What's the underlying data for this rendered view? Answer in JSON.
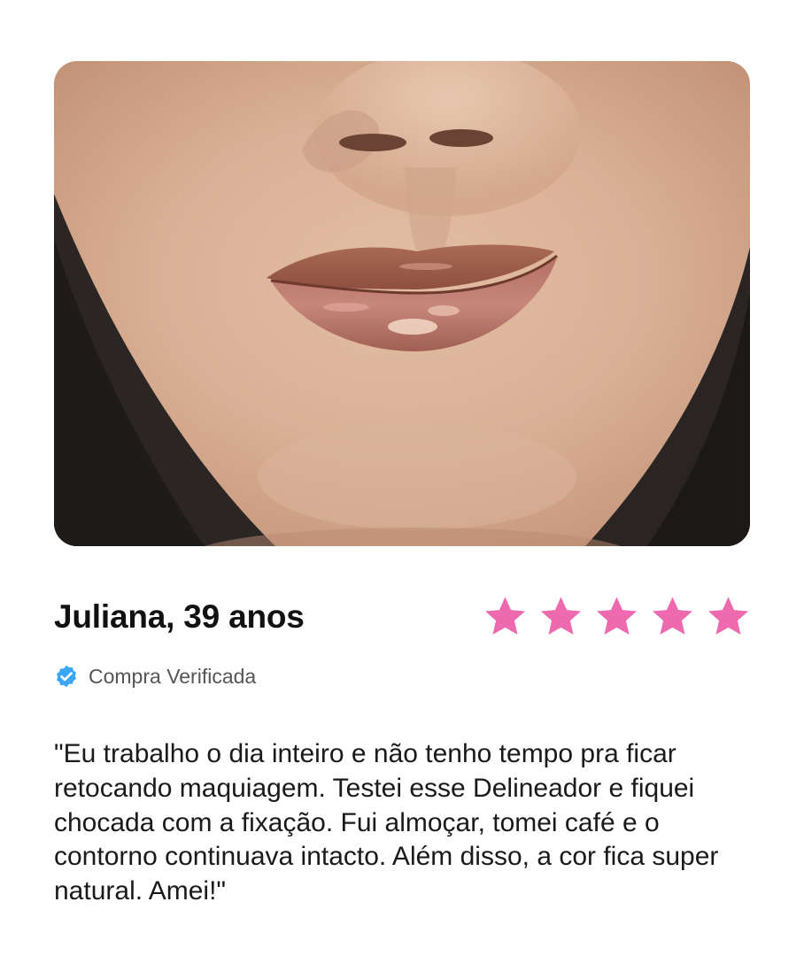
{
  "review": {
    "photo_description": "lip-product-swatch-photo",
    "reviewer": "Juliana, 39 anos",
    "rating": 5,
    "rating_max": 5,
    "verified_label": "Compra Verificada",
    "text": "\"Eu trabalho o dia inteiro e não tenho tempo pra ficar retocando maquiagem. Testei esse Delineador e fiquei chocada com a fixação. Fui almoçar, tomei café e o contorno continuava intacto. Além disso, a cor fica super natural. Amei!\""
  },
  "icons": {
    "star": "star-icon",
    "verified": "check-badge-icon"
  },
  "colors": {
    "star": "#ee6aae",
    "verified_badge": "#3aa6f5"
  }
}
